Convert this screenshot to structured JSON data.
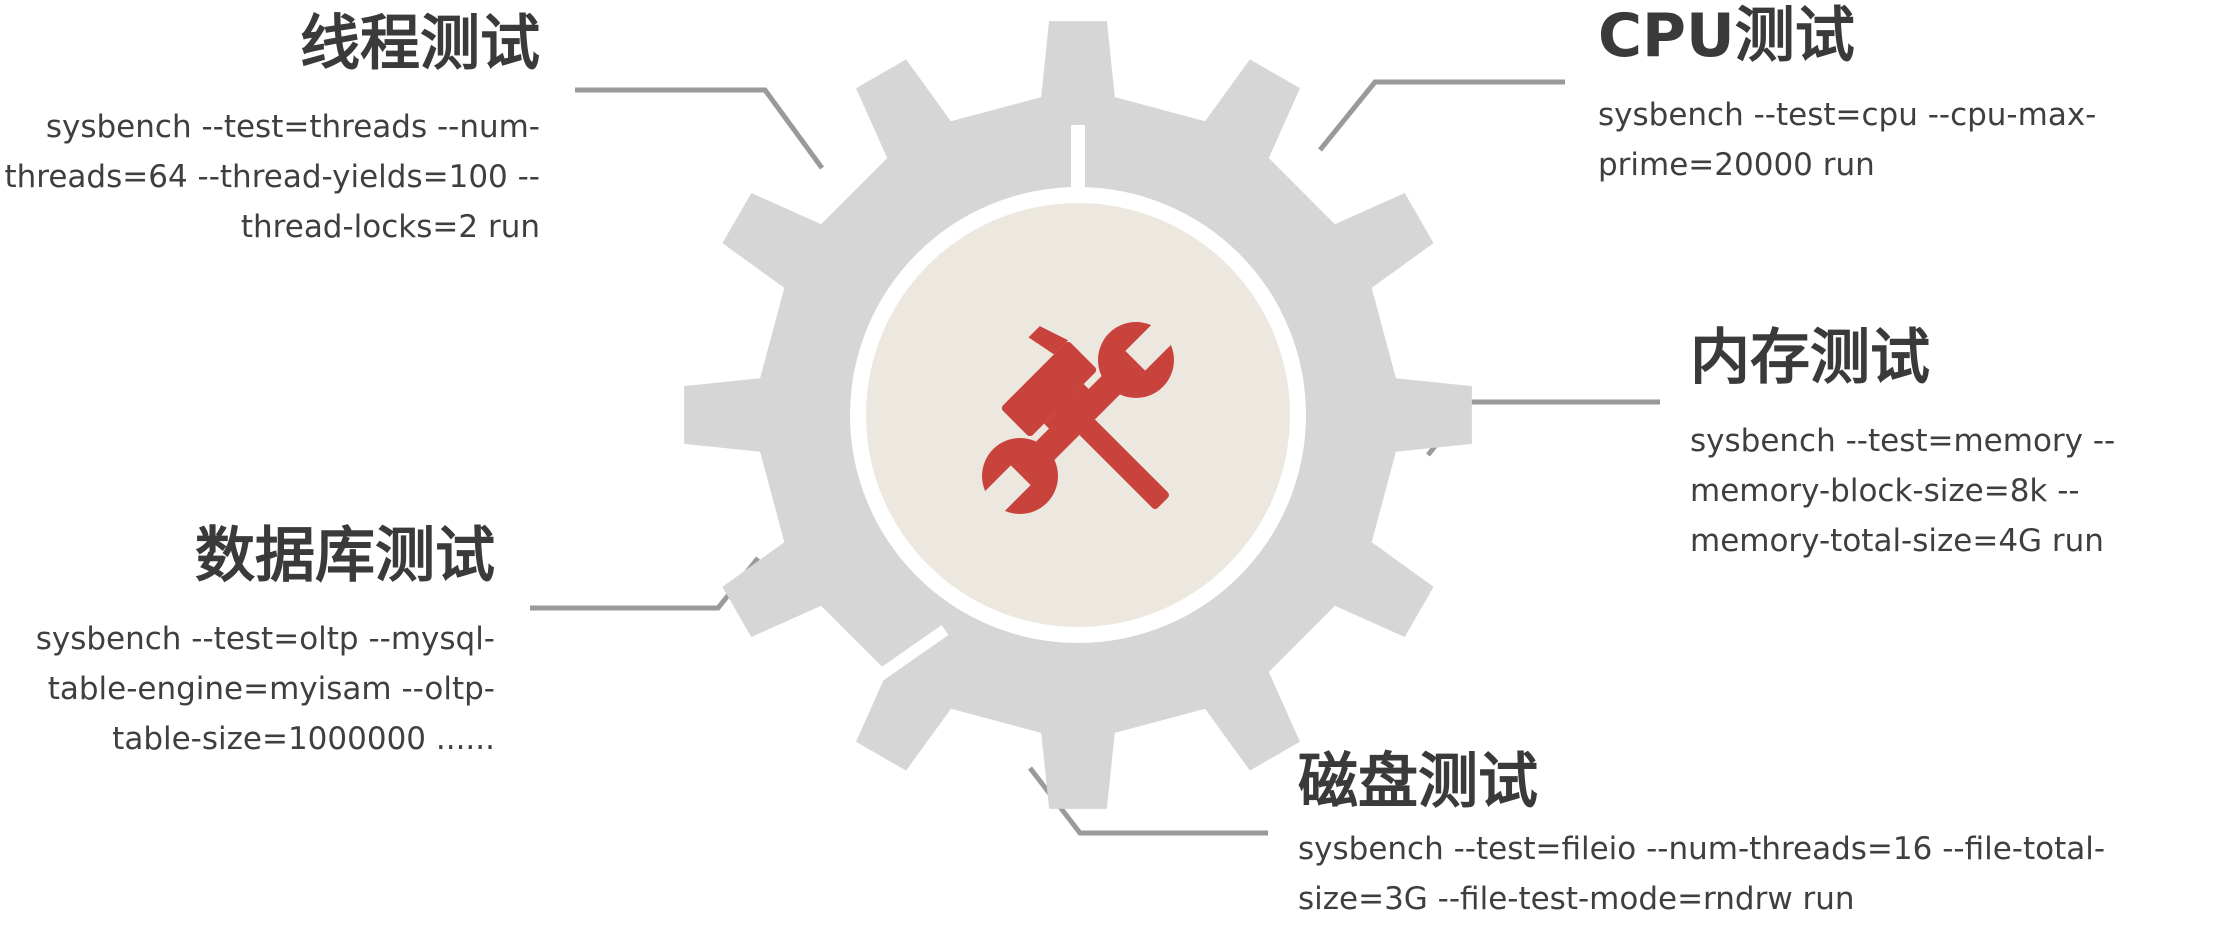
{
  "colors": {
    "gear": "#d6d6d6",
    "center": "#ece8df",
    "tool": "#c9433d",
    "connector": "#9a9a9a",
    "text": "#3f3f3f"
  },
  "center_icon": "hammer-wrench-icon",
  "sections": {
    "threads": {
      "title": "线程测试",
      "lines": [
        "sysbench --test=threads --num-",
        "threads=64 --thread-yields=100 --",
        "thread-locks=2 run"
      ]
    },
    "cpu": {
      "title": "CPU测试",
      "lines": [
        "sysbench --test=cpu --cpu-max-",
        "prime=20000 run"
      ]
    },
    "memory": {
      "title": "内存测试",
      "lines": [
        "sysbench --test=memory --",
        "memory-block-size=8k --",
        "memory-total-size=4G run"
      ]
    },
    "database": {
      "title": "数据库测试",
      "lines": [
        "sysbench --test=oltp --mysql-",
        "table-engine=myisam --oltp-",
        "table-size=1000000 ......"
      ]
    },
    "disk": {
      "title": "磁盘测试",
      "lines": [
        "sysbench --test=fileio --num-threads=16 --file-total-",
        "size=3G --file-test-mode=rndrw run"
      ]
    }
  }
}
